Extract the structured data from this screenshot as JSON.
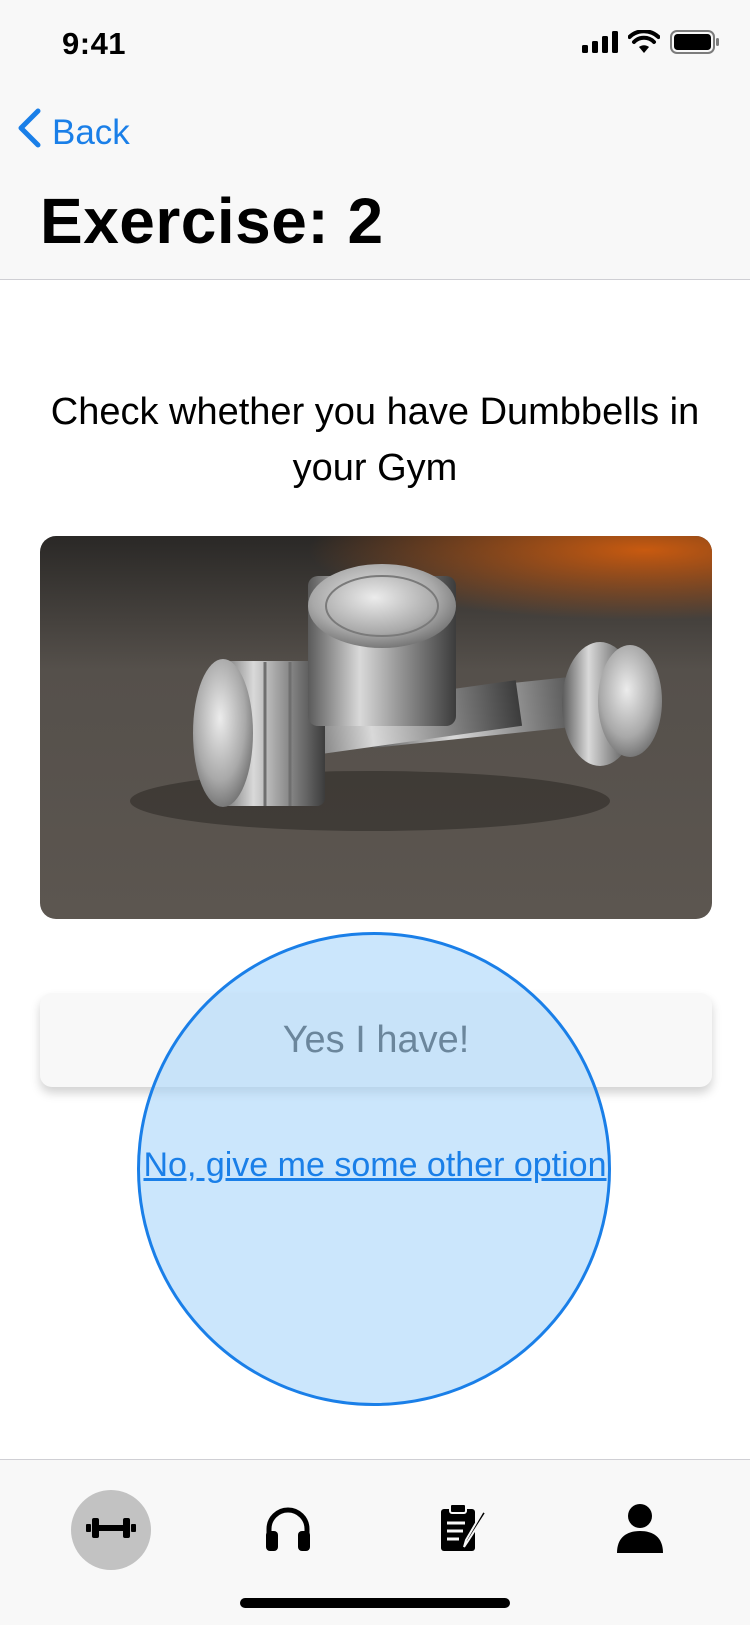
{
  "status_bar": {
    "time": "9:41",
    "icons": [
      "cellular-signal-icon",
      "wifi-icon",
      "battery-icon"
    ]
  },
  "nav": {
    "back_label": "Back",
    "title": "Exercise: 2"
  },
  "main": {
    "prompt": "Check whether you have Dumbbells in your Gym",
    "image_subject": "dumbbells-photo",
    "yes_button_label": "Yes I have!",
    "no_link_label": "No, give me some other option"
  },
  "tab_bar": {
    "tabs": [
      {
        "icon": "dumbbell-icon",
        "active": true
      },
      {
        "icon": "headphones-icon",
        "active": false
      },
      {
        "icon": "clipboard-edit-icon",
        "active": false
      },
      {
        "icon": "person-icon",
        "active": false
      }
    ]
  },
  "colors": {
    "accent": "#1a7fe8",
    "highlight_fill": "#a8d6fa",
    "active_tab_bg": "#c2c2c2"
  }
}
